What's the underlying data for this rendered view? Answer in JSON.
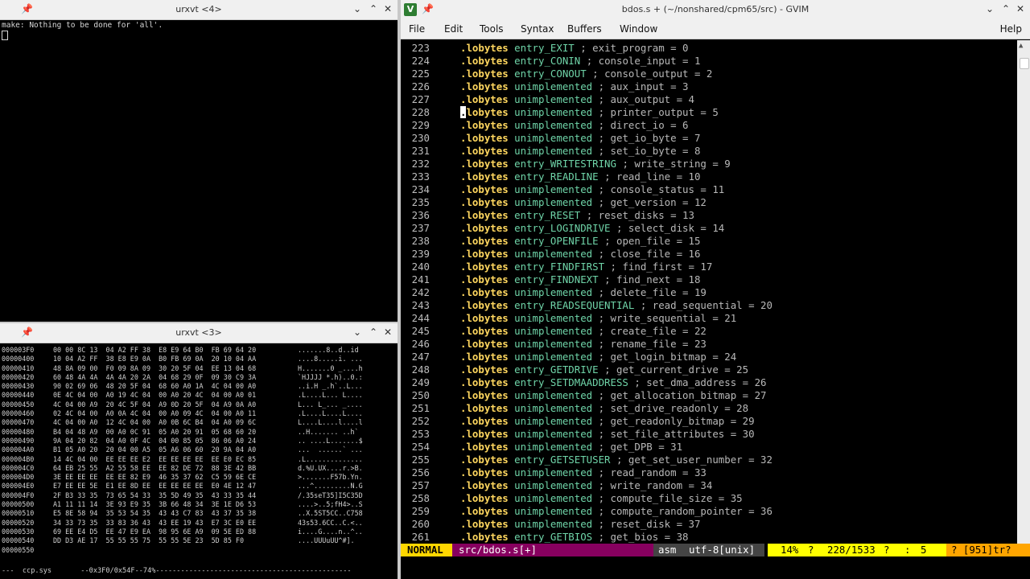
{
  "urxvt4": {
    "title": "urxvt <4>",
    "output": "make: Nothing to be done for 'all'."
  },
  "urxvt3": {
    "title": "urxvt <3>",
    "hex_rows": [
      {
        "addr": "000003F0",
        "bytes": "00 00 8C 13  04 A2 FF 38  E8 E9 64 B0  FB 69 64 20",
        "ascii": ".......8..d..id"
      },
      {
        "addr": "00000400",
        "bytes": "10 04 A2 FF  38 E8 E9 0A  B0 FB 69 0A  20 10 04 AA",
        "ascii": "....8.....i. ..."
      },
      {
        "addr": "00000410",
        "bytes": "48 8A 09 00  F0 09 8A 09  30 20 5F 04  EE 13 04 68",
        "ascii": "H.......0 _....h"
      },
      {
        "addr": "00000420",
        "bytes": "60 48 4A 4A  4A 4A 20 2A  04 68 29 0F  09 30 C9 3A",
        "ascii": "`HJJJJ *.h)..0.:"
      },
      {
        "addr": "00000430",
        "bytes": "90 02 69 06  48 20 5F 04  68 60 A0 1A  4C 04 00 A0",
        "ascii": "..i.H _.h`..L..."
      },
      {
        "addr": "00000440",
        "bytes": "0E 4C 04 00  A0 19 4C 04  00 A0 20 4C  04 00 A0 01",
        "ascii": ".L....L... L...."
      },
      {
        "addr": "00000450",
        "bytes": "4C 04 00 A9  20 4C 5F 04  A9 0D 20 5F  04 A9 0A A0",
        "ascii": "L... L_... _...."
      },
      {
        "addr": "00000460",
        "bytes": "02 4C 04 00  A0 0A 4C 04  00 A0 09 4C  04 00 A0 11",
        "ascii": ".L....L....L...."
      },
      {
        "addr": "00000470",
        "bytes": "4C 04 00 A0  12 4C 04 00  A0 0B 6C B4  04 A0 09 6C",
        "ascii": "L....L....l....l"
      },
      {
        "addr": "00000480",
        "bytes": "B4 04 48 A9  00 A0 0C 91  05 A0 20 91  05 68 60 20",
        "ascii": "..H....... ..h` "
      },
      {
        "addr": "00000490",
        "bytes": "9A 04 20 82  04 A0 0F 4C  04 00 85 05  86 06 A0 24",
        "ascii": ".. ....L.......$"
      },
      {
        "addr": "000004A0",
        "bytes": "B1 05 A0 20  20 04 00 A5  05 A6 06 60  20 9A 04 A0",
        "ascii": "...  ......` ..."
      },
      {
        "addr": "000004B0",
        "bytes": "14 4C 04 00  EE EE EE E2  EE EE EE EE  EE E0 EC 85",
        "ascii": ".L.............."
      },
      {
        "addr": "000004C0",
        "bytes": "64 EB 25 55  A2 55 58 EE  EE 82 DE 72  88 3E 42 BB",
        "ascii": "d.%U.UX....r.>B."
      },
      {
        "addr": "000004D0",
        "bytes": "3E EE EE EE  EE EE 82 E9  46 35 37 62  C5 59 6E CE",
        "ascii": ">.......F57b.Yn."
      },
      {
        "addr": "000004E0",
        "bytes": "E7 EE EE 5E  E1 EE 8D EE  EE EE EE EE  E0 4E 12 47",
        "ascii": "...^.........N.G"
      },
      {
        "addr": "000004F0",
        "bytes": "2F B3 33 35  73 65 54 33  35 5D 49 35  43 33 35 44",
        "ascii": "/.35seT35]I5C35D"
      },
      {
        "addr": "00000500",
        "bytes": "A1 11 11 14  3E 93 E9 35  3B 66 48 34  3E 1E D6 53",
        "ascii": "....>..5;fH4>..S"
      },
      {
        "addr": "00000510",
        "bytes": "E5 8E 58 94  35 53 54 35  43 43 C7 83  43 37 35 38",
        "ascii": "..X.5ST5CC..C758"
      },
      {
        "addr": "00000520",
        "bytes": "34 33 73 35  33 83 36 43  43 EE 19 43  E7 3C E0 EE",
        "ascii": "43s53.6CC..C.<.."
      },
      {
        "addr": "00000530",
        "bytes": "69 EE E4 D5  EE 47 E9 EA  98 95 6E A9  09 5E ED 88",
        "ascii": "i....G....n..^.."
      },
      {
        "addr": "00000540",
        "bytes": "DD D3 AE 17  55 55 55 75  55 55 5E 23  5D 85 F0",
        "ascii": "....UUUuUU^#]."
      },
      {
        "addr": "00000550",
        "bytes": "",
        "ascii": ""
      }
    ],
    "status": "---  ccp.sys       --0x3F0/0x54F--74%-----------------------------------------------"
  },
  "gvim": {
    "title": "bdos.s + (~/nonshared/cpm65/src) - GVIM",
    "menu": [
      "File",
      "Edit",
      "Tools",
      "Syntax",
      "Buffers",
      "Window"
    ],
    "help": "Help",
    "lines": [
      {
        "n": "223",
        "name": "entry_EXIT",
        "comment": "; exit_program = 0"
      },
      {
        "n": "224",
        "name": "entry_CONIN",
        "comment": "; console_input = 1"
      },
      {
        "n": "225",
        "name": "entry_CONOUT",
        "comment": "; console_output = 2"
      },
      {
        "n": "226",
        "name": "unimplemented",
        "comment": "; aux_input = 3"
      },
      {
        "n": "227",
        "name": "unimplemented",
        "comment": "; aux_output = 4"
      },
      {
        "n": "228",
        "name": "unimplemented",
        "comment": "; printer_output = 5"
      },
      {
        "n": "229",
        "name": "unimplemented",
        "comment": "; direct_io = 6"
      },
      {
        "n": "230",
        "name": "unimplemented",
        "comment": "; get_io_byte = 7"
      },
      {
        "n": "231",
        "name": "unimplemented",
        "comment": "; set_io_byte = 8"
      },
      {
        "n": "232",
        "name": "entry_WRITESTRING",
        "comment": "; write_string = 9"
      },
      {
        "n": "233",
        "name": "entry_READLINE",
        "comment": "; read_line = 10"
      },
      {
        "n": "234",
        "name": "unimplemented",
        "comment": "; console_status = 11"
      },
      {
        "n": "235",
        "name": "unimplemented",
        "comment": "; get_version = 12"
      },
      {
        "n": "236",
        "name": "entry_RESET",
        "comment": "; reset_disks = 13"
      },
      {
        "n": "237",
        "name": "entry_LOGINDRIVE",
        "comment": "; select_disk = 14"
      },
      {
        "n": "238",
        "name": "entry_OPENFILE",
        "comment": "; open_file = 15"
      },
      {
        "n": "239",
        "name": "unimplemented",
        "comment": "; close_file = 16"
      },
      {
        "n": "240",
        "name": "entry_FINDFIRST",
        "comment": "; find_first = 17"
      },
      {
        "n": "241",
        "name": "entry_FINDNEXT",
        "comment": "; find_next = 18"
      },
      {
        "n": "242",
        "name": "unimplemented",
        "comment": "; delete_file = 19"
      },
      {
        "n": "243",
        "name": "entry_READSEQUENTIAL",
        "comment": "; read_sequential = 20"
      },
      {
        "n": "244",
        "name": "unimplemented",
        "comment": "; write_sequential = 21"
      },
      {
        "n": "245",
        "name": "unimplemented",
        "comment": "; create_file = 22"
      },
      {
        "n": "246",
        "name": "unimplemented",
        "comment": "; rename_file = 23"
      },
      {
        "n": "247",
        "name": "unimplemented",
        "comment": "; get_login_bitmap = 24"
      },
      {
        "n": "248",
        "name": "entry_GETDRIVE",
        "comment": "; get_current_drive = 25"
      },
      {
        "n": "249",
        "name": "entry_SETDMAADDRESS",
        "comment": "; set_dma_address = 26"
      },
      {
        "n": "250",
        "name": "unimplemented",
        "comment": "; get_allocation_bitmap = 27"
      },
      {
        "n": "251",
        "name": "unimplemented",
        "comment": "; set_drive_readonly = 28"
      },
      {
        "n": "252",
        "name": "unimplemented",
        "comment": "; get_readonly_bitmap = 29"
      },
      {
        "n": "253",
        "name": "unimplemented",
        "comment": "; set_file_attributes = 30"
      },
      {
        "n": "254",
        "name": "unimplemented",
        "comment": "; get_DPB = 31"
      },
      {
        "n": "255",
        "name": "entry_GETSETUSER",
        "comment": "; get_set_user_number = 32"
      },
      {
        "n": "256",
        "name": "unimplemented",
        "comment": "; read_random = 33"
      },
      {
        "n": "257",
        "name": "unimplemented",
        "comment": "; write_random = 34"
      },
      {
        "n": "258",
        "name": "unimplemented",
        "comment": "; compute_file_size = 35"
      },
      {
        "n": "259",
        "name": "unimplemented",
        "comment": "; compute_random_pointer = 36"
      },
      {
        "n": "260",
        "name": "unimplemented",
        "comment": "; reset_disk = 37"
      },
      {
        "n": "261",
        "name": "entry_GETBIOS",
        "comment": "; get_bios = 38"
      }
    ],
    "directive": ".lobytes",
    "cursor_line": "228",
    "scroll_fraction": 0.14,
    "status": {
      "mode": "NORMAL",
      "file": "src/bdos.s[+]",
      "filetype": "asm",
      "encoding": "utf-8[unix]",
      "percent": "14%",
      "sep1": "?",
      "position": "228/1533",
      "sep2": "?",
      "colsep": ":",
      "col": "5",
      "warn": "? [951]tr?"
    },
    "colors": {
      "mode_bg": "#ffd700",
      "file_bg": "#87005f",
      "info_bg": "#444444",
      "pos_bg": "#ffff00",
      "warn_bg": "#ffa500",
      "keyword": "#ffd75f",
      "identifier": "#6fd4a8"
    }
  }
}
